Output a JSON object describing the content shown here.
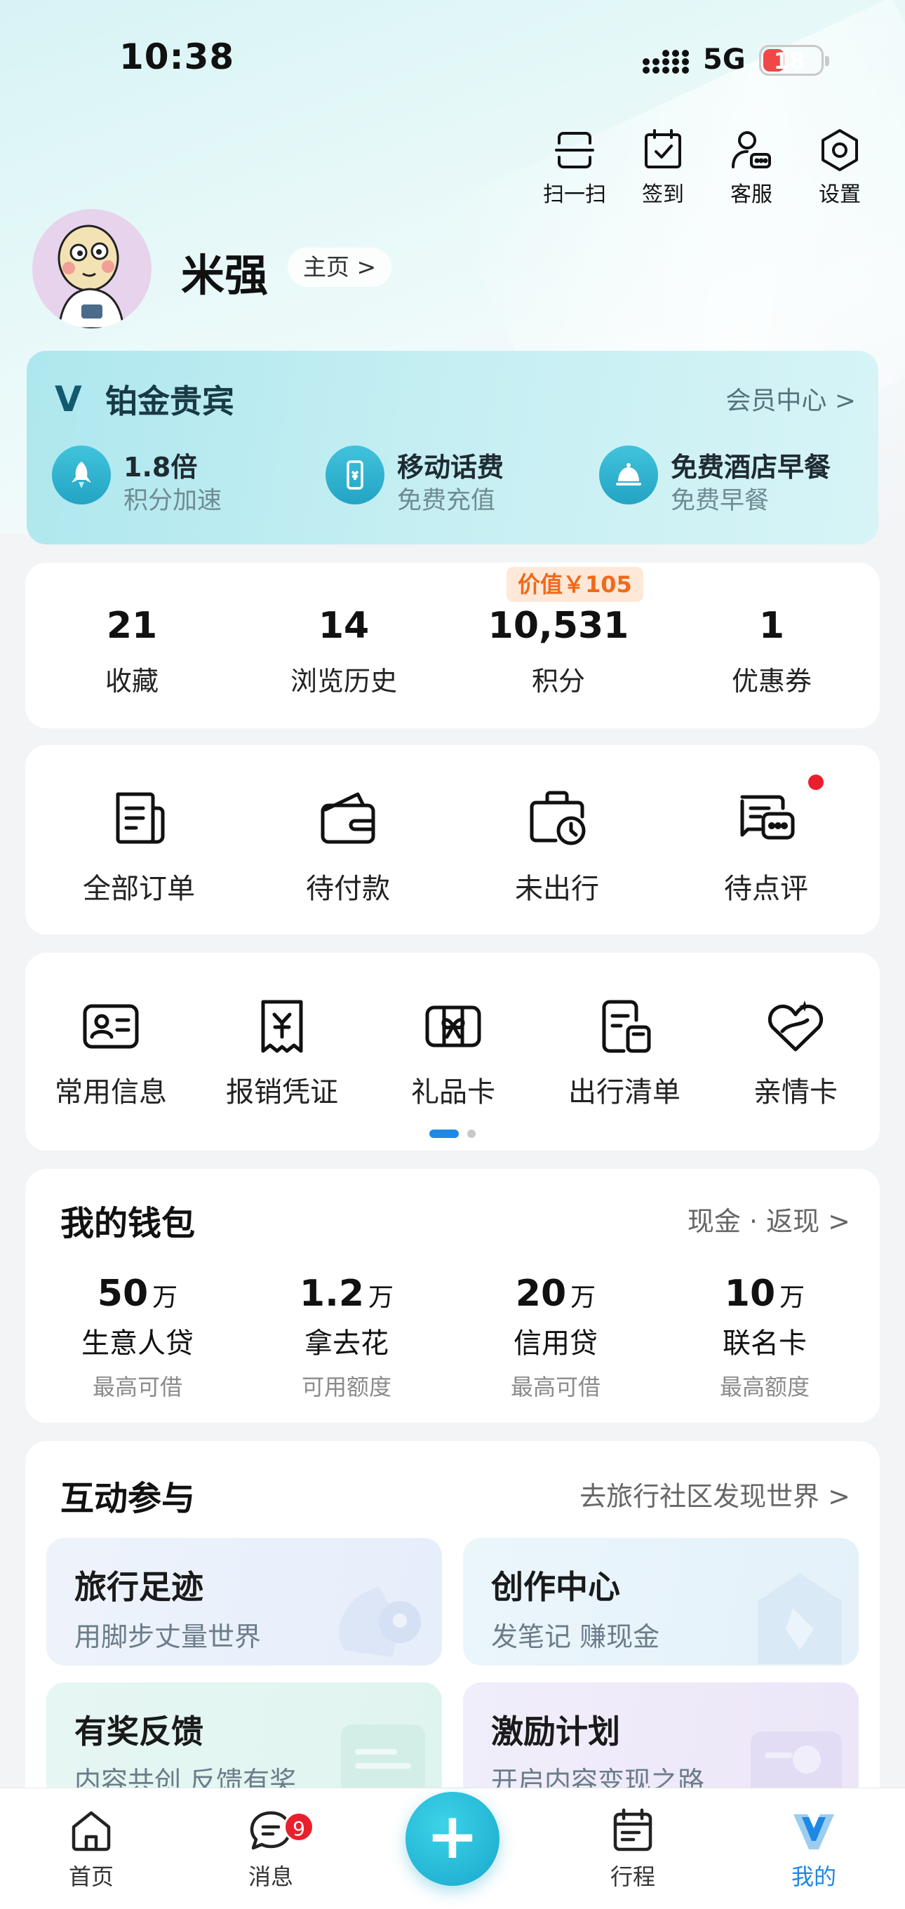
{
  "status_bar": {
    "time": "10:38",
    "network": "5G",
    "battery": "18",
    "battery_color": "#f04747"
  },
  "top_actions": [
    {
      "label": "扫一扫",
      "icon": "scan-icon"
    },
    {
      "label": "签到",
      "icon": "checkin-calendar-icon"
    },
    {
      "label": "客服",
      "icon": "customer-service-icon"
    },
    {
      "label": "设置",
      "icon": "gear-icon"
    }
  ],
  "profile": {
    "username": "米强",
    "home_link": "主页 >"
  },
  "membership": {
    "logo": "V",
    "level": "铂金贵宾",
    "center_link": "会员中心 >",
    "accent": "#23a4c4",
    "benefits": [
      {
        "title": "1.8倍",
        "subtitle": "积分加速",
        "icon": "rocket-icon"
      },
      {
        "title": "移动话费",
        "subtitle": "免费充值",
        "icon": "phone-icon"
      },
      {
        "title": "免费酒店早餐",
        "subtitle": "免费早餐",
        "icon": "dining-cloche-icon"
      }
    ]
  },
  "stats": {
    "value_badge": "价值￥105",
    "items": [
      {
        "value": "21",
        "label": "收藏"
      },
      {
        "value": "14",
        "label": "浏览历史"
      },
      {
        "value": "10,531",
        "label": "积分"
      },
      {
        "value": "1",
        "label": "优惠券"
      }
    ]
  },
  "orders": [
    {
      "label": "全部订单",
      "icon": "all-orders-icon"
    },
    {
      "label": "待付款",
      "icon": "wallet-icon"
    },
    {
      "label": "未出行",
      "icon": "bag-clock-icon"
    },
    {
      "label": "待点评",
      "icon": "review-chat-icon"
    }
  ],
  "tools": {
    "items": [
      {
        "label": "常用信息",
        "icon": "id-card-icon"
      },
      {
        "label": "报销凭证",
        "icon": "receipt-icon"
      },
      {
        "label": "礼品卡",
        "icon": "gift-card-icon"
      },
      {
        "label": "出行清单",
        "icon": "checklist-icon"
      },
      {
        "label": "亲情卡",
        "icon": "family-card-icon"
      }
    ],
    "page": 1,
    "pages": 2
  },
  "wallet": {
    "title": "我的钱包",
    "link": "现金 · 返现 >",
    "items": [
      {
        "amount": "50",
        "unit": "万",
        "name": "生意人贷",
        "note": "最高可借"
      },
      {
        "amount": "1.2",
        "unit": "万",
        "name": "拿去花",
        "note": "可用额度"
      },
      {
        "amount": "20",
        "unit": "万",
        "name": "信用贷",
        "note": "最高可借"
      },
      {
        "amount": "10",
        "unit": "万",
        "name": "联名卡",
        "note": "最高额度"
      }
    ]
  },
  "interaction": {
    "title": "互动参与",
    "link": "去旅行社区发现世界 >",
    "tiles": [
      {
        "title": "旅行足迹",
        "subtitle": "用脚步丈量世界"
      },
      {
        "title": "创作中心",
        "subtitle": "发笔记 赚现金"
      },
      {
        "title": "有奖反馈",
        "subtitle": "内容共创 反馈有奖"
      },
      {
        "title": "激励计划",
        "subtitle": "开启内容变现之路"
      }
    ]
  },
  "tabbar": {
    "items": [
      {
        "label": "首页",
        "icon": "home-icon"
      },
      {
        "label": "消息",
        "icon": "message-icon",
        "badge": "9"
      },
      {
        "label": "行程",
        "icon": "itinerary-icon"
      },
      {
        "label": "我的",
        "icon": "my-v-icon",
        "active": true
      }
    ],
    "fab": "+",
    "active_color": "#1e88e5"
  }
}
